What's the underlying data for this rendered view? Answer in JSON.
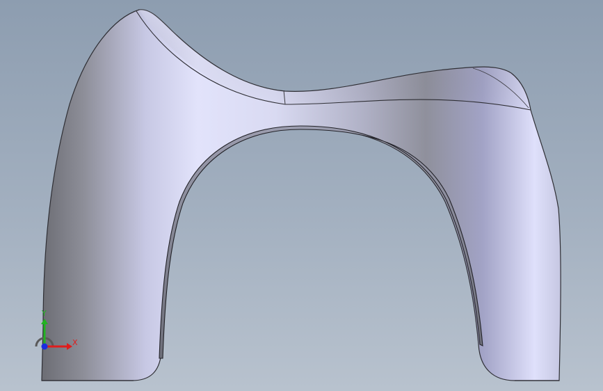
{
  "viewport": {
    "background_top": "#8d9db0",
    "background_bottom": "#b8c2ce"
  },
  "model": {
    "body_color_light": "#e2e3fb",
    "body_color_mid": "#babbd4",
    "body_color_dark": "#76777f",
    "edge_color": "#2e2e34"
  },
  "triad": {
    "x_label": "X",
    "y_label": "Y",
    "x_color": "#e01c1c",
    "y_color": "#22b422",
    "z_color": "#1c2ce0"
  }
}
